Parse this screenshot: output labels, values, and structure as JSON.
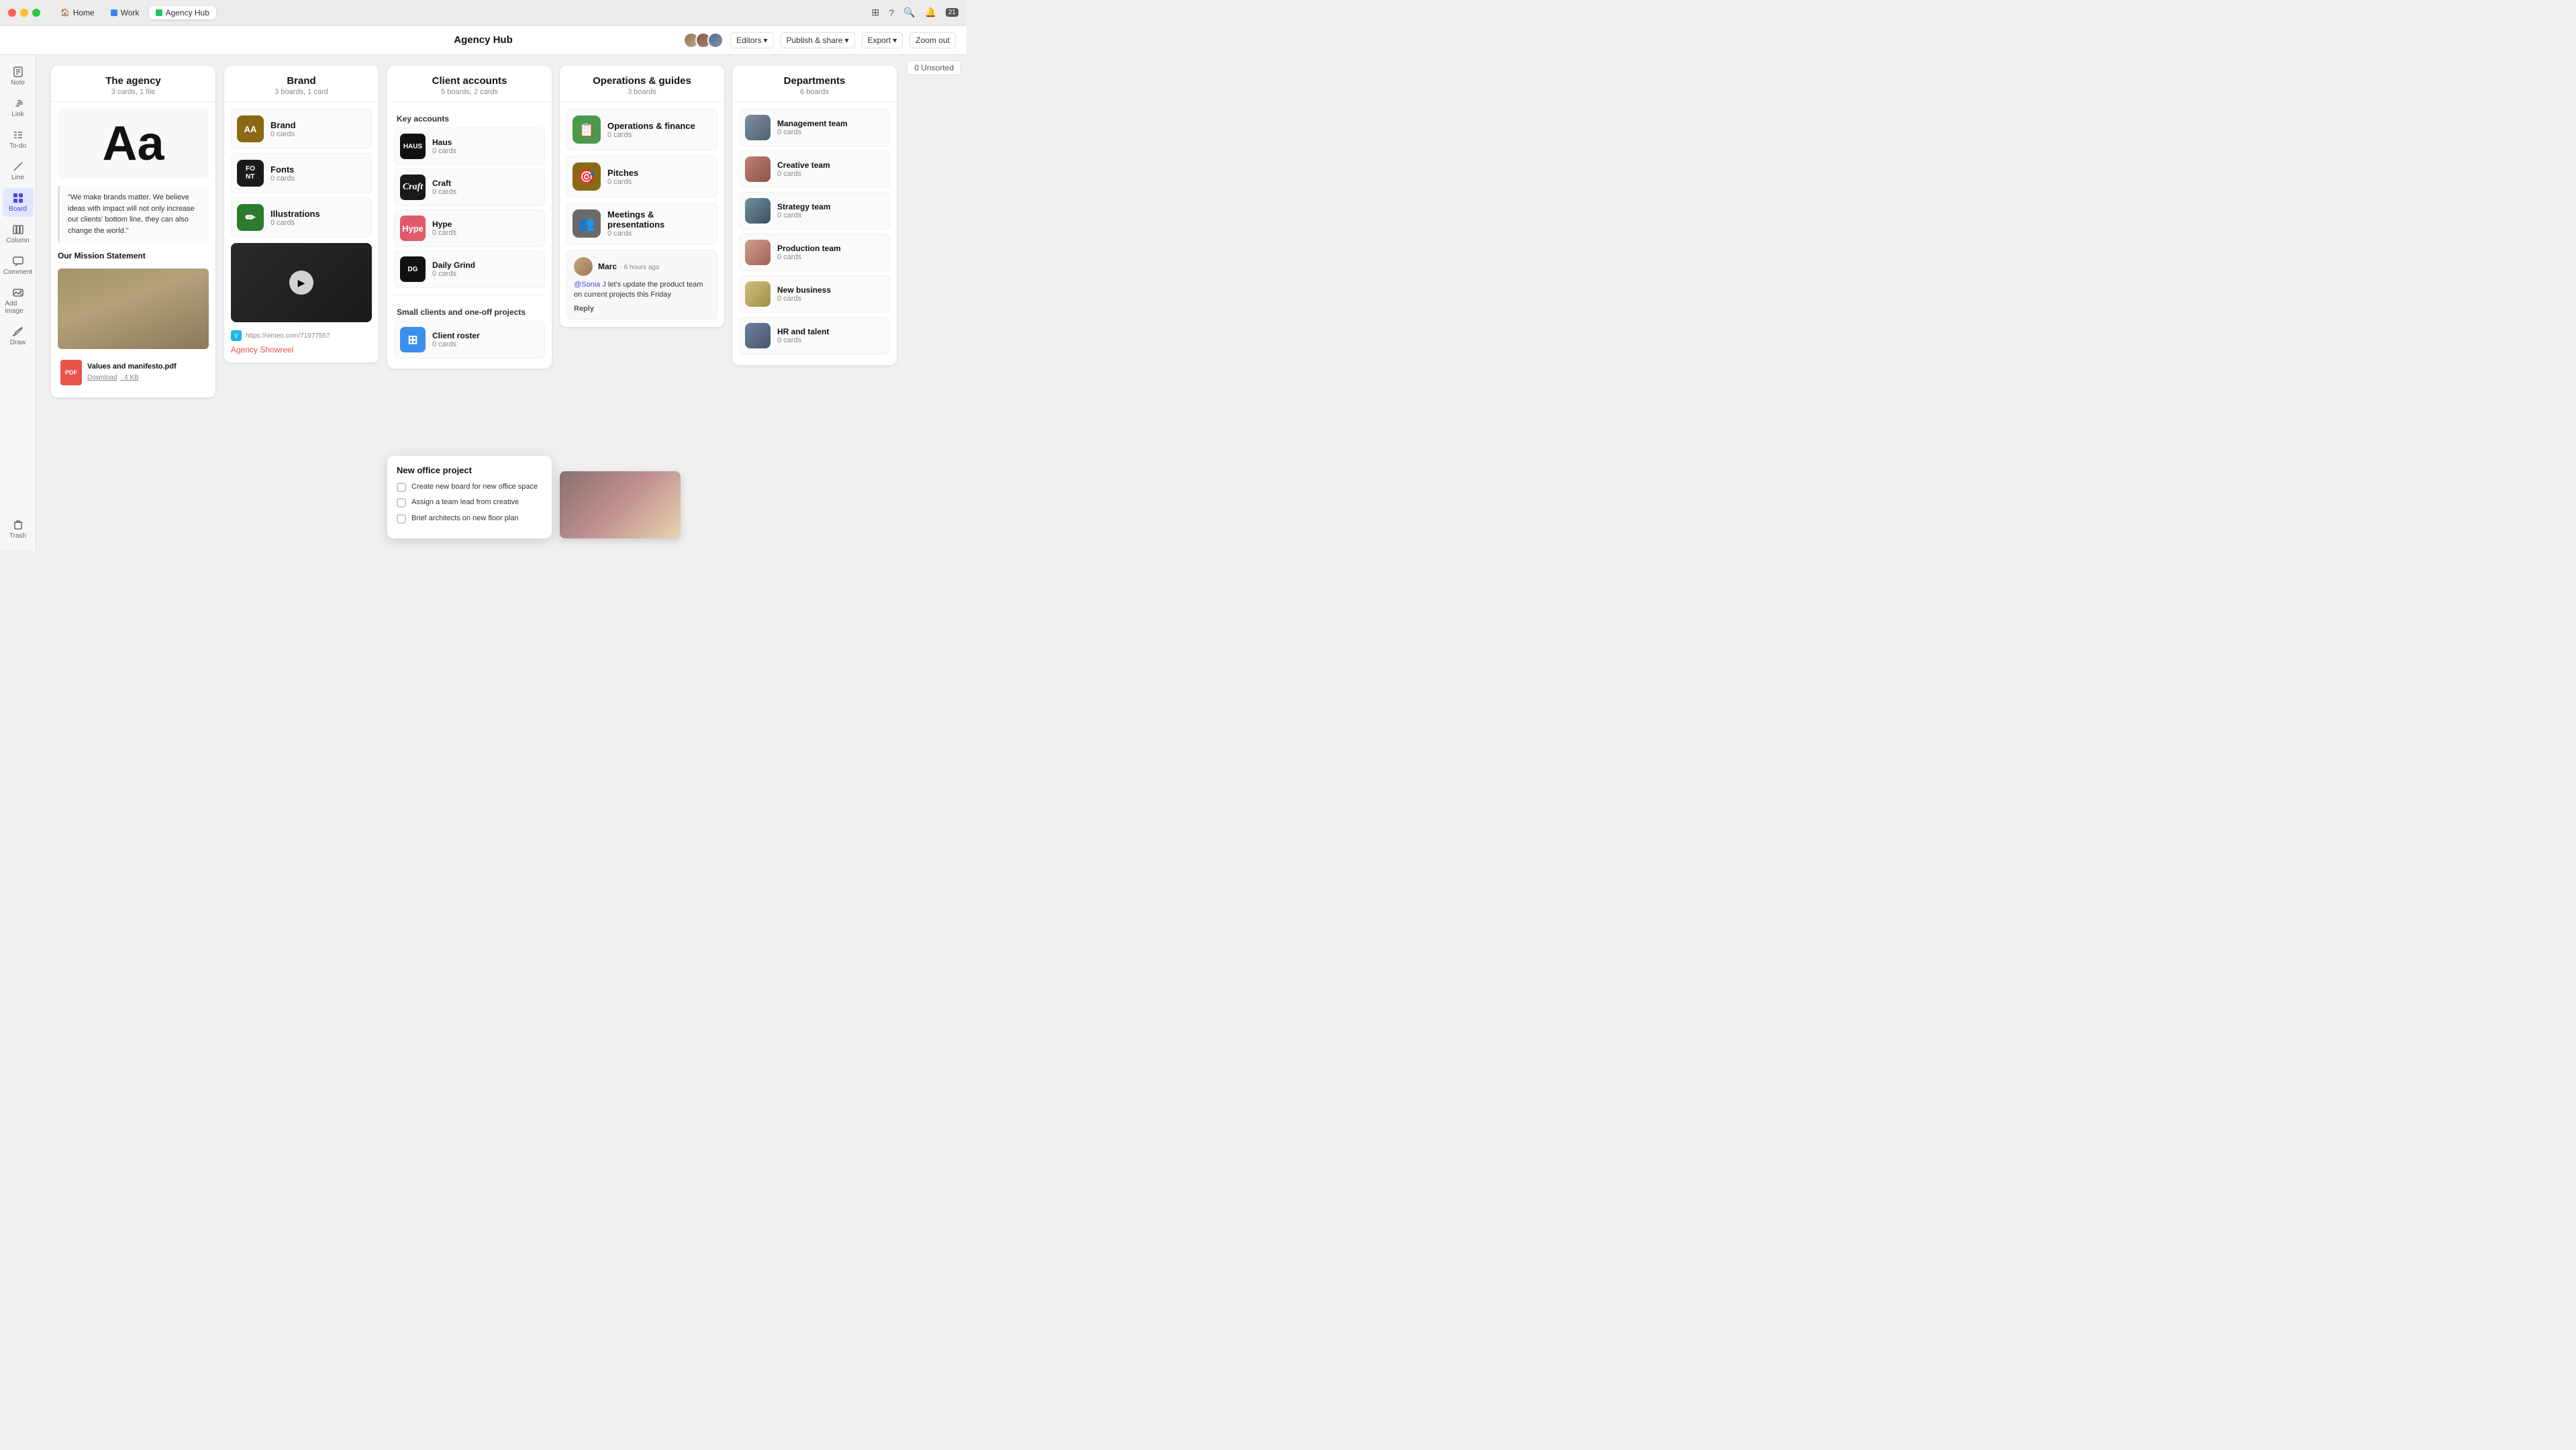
{
  "titlebar": {
    "tabs": [
      {
        "label": "Home",
        "icon": "🏠",
        "active": false
      },
      {
        "label": "Work",
        "color": "#3b82f6",
        "active": false
      },
      {
        "label": "Agency Hub",
        "color": "#22c55e",
        "active": true
      }
    ],
    "right": {
      "notifications": "21",
      "icons": [
        "bell",
        "search",
        "question",
        "grid"
      ]
    }
  },
  "topbar": {
    "title": "Agency Hub",
    "editors_label": "Editors",
    "publish_label": "Publish & share",
    "export_label": "Export",
    "zoom_label": "Zoom out"
  },
  "sidebar": {
    "items": [
      {
        "label": "Note",
        "icon": "note"
      },
      {
        "label": "Link",
        "icon": "link"
      },
      {
        "label": "To-do",
        "icon": "todo"
      },
      {
        "label": "Line",
        "icon": "line"
      },
      {
        "label": "Board",
        "icon": "board",
        "active": true
      },
      {
        "label": "Column",
        "icon": "column"
      },
      {
        "label": "Comment",
        "icon": "comment"
      },
      {
        "label": "Add image",
        "icon": "image"
      },
      {
        "label": "Draw",
        "icon": "draw"
      }
    ],
    "trash": "Trash"
  },
  "unsorted": "0 Unsorted",
  "columns": {
    "agency": {
      "title": "The agency",
      "subtitle": "3 cards, 1 file",
      "big_text": "Aa",
      "quote": "\"We make brands matter. We believe ideas with impact will not only increase our clients' bottom line, they can also change the world.\"",
      "mission": "Our Mission Statement",
      "pdf": {
        "name": "Values and manifesto.pdf",
        "link_text": "Download",
        "size": "4 KB"
      }
    },
    "brand": {
      "title": "Brand",
      "subtitle": "3 boards, 1 card",
      "boards": [
        {
          "name": "Brand",
          "count": "0 cards",
          "bg": "brown",
          "initials": "AA"
        },
        {
          "name": "Fonts",
          "count": "0 cards",
          "bg": "dark",
          "initials": "FO\nNT"
        },
        {
          "name": "Illustrations",
          "count": "0 cards",
          "bg": "green",
          "initials": "✏"
        }
      ],
      "vimeo_url": "https://vimeo.com/71977557",
      "showreel": "Agency Showreel"
    },
    "clients": {
      "title": "Client accounts",
      "subtitle": "5 boards, 2 cards",
      "key_accounts_label": "Key accounts",
      "items": [
        {
          "name": "Haus",
          "count": "0 cards",
          "bg": "#111"
        },
        {
          "name": "Craft",
          "count": "0 cards",
          "bg": "#111"
        },
        {
          "name": "Hype",
          "count": "0 cards",
          "bg": "#e05a6a"
        },
        {
          "name": "Daily Grind",
          "count": "0 cards",
          "bg": "#111"
        }
      ],
      "small_clients_label": "Small clients and one-off projects",
      "small_items": [
        {
          "name": "Client roster",
          "count": "0 cards",
          "bg": "#3b8fef"
        }
      ]
    },
    "operations": {
      "title": "Operations & guides",
      "subtitle": "3 boards",
      "items": [
        {
          "name": "Operations & finance",
          "count": "0 cards",
          "bg": "#4a9a4a",
          "emoji": "📋"
        },
        {
          "name": "Pitches",
          "count": "0 cards",
          "bg": "#8b6914",
          "emoji": "🎯"
        },
        {
          "name": "Meetings & presentations",
          "count": "0 cards",
          "bg": "#6a6a6a",
          "emoji": "👥"
        }
      ],
      "comment": {
        "user": "Marc",
        "time": "6 hours ago",
        "mention": "@Sonia J",
        "text": " let's update the product team on current projects this Friday",
        "reply": "Reply"
      }
    },
    "departments": {
      "title": "Departments",
      "subtitle": "6 boards",
      "items": [
        {
          "name": "Management team",
          "count": "0 cards"
        },
        {
          "name": "Creative team",
          "count": "0 cards"
        },
        {
          "name": "Strategy team",
          "count": "0 cards"
        },
        {
          "name": "Production team",
          "count": "0 cards"
        },
        {
          "name": "New business",
          "count": "0 cards"
        },
        {
          "name": "HR and talent",
          "count": "0 cards"
        }
      ]
    }
  },
  "floating_card": {
    "title": "New office project",
    "items": [
      "Create new board for new office space",
      "Assign a team lead from creative",
      "Brief architects on new floor plan"
    ]
  }
}
